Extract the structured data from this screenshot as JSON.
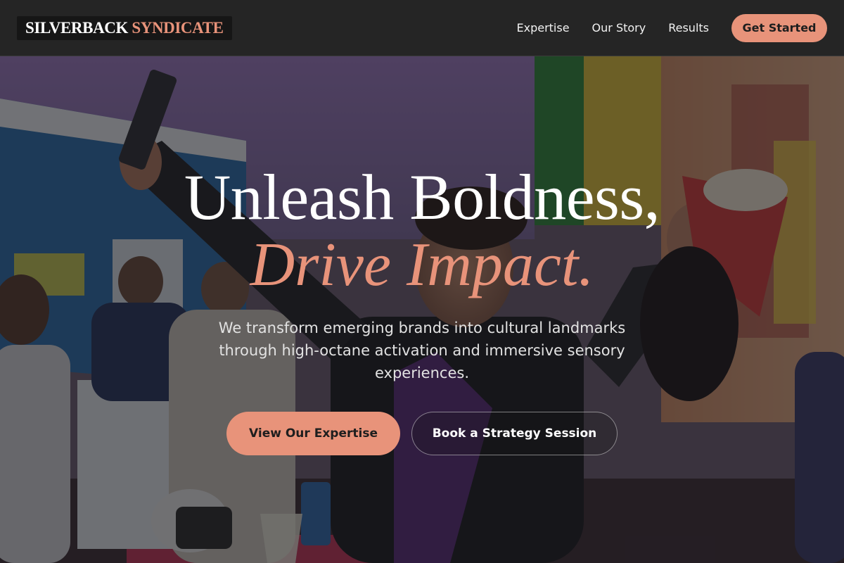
{
  "brand": {
    "name_part1": "SILVERBACK",
    "name_part2": "SYNDICATE"
  },
  "nav": {
    "links": [
      "Expertise",
      "Our Story",
      "Results"
    ],
    "cta_label": "Get Started"
  },
  "hero": {
    "headline_line1": "Unleash Boldness,",
    "headline_line2": "Drive Impact.",
    "subheadline": "We transform emerging brands into cultural landmarks through high-octane activation and immersive sensory experiences.",
    "primary_button": "View Our Expertise",
    "secondary_button": "Book a Strategy Session"
  },
  "colors": {
    "accent": "#e8937a",
    "nav_bg": "#252525",
    "logo_bg": "#161616",
    "overlay": "rgba(20,20,24,0.58)"
  },
  "icons": {}
}
